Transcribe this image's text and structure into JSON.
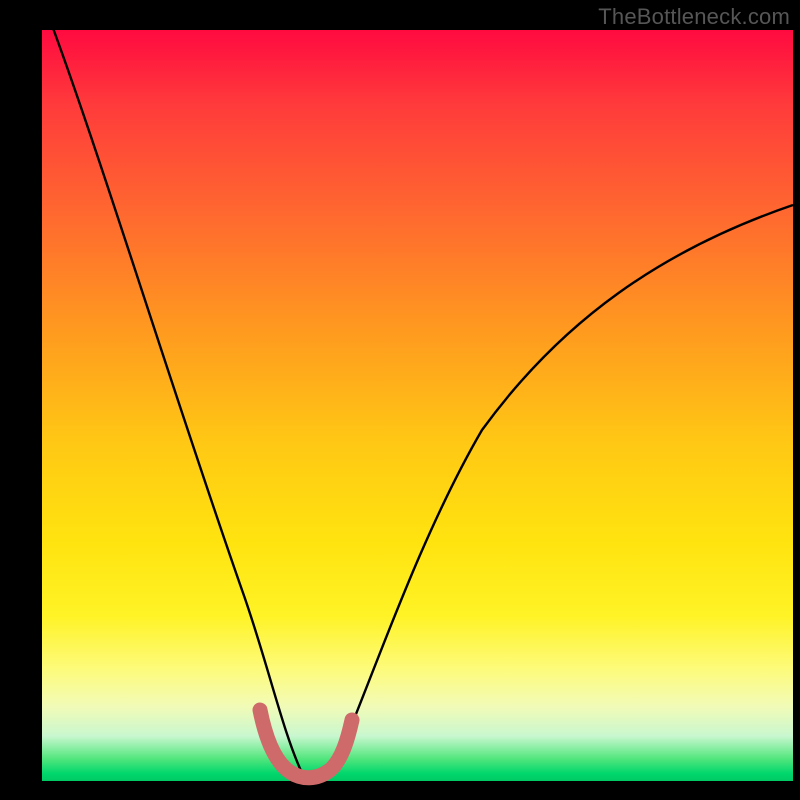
{
  "watermark": "TheBottleneck.com",
  "chart_data": {
    "type": "line",
    "title": "",
    "xlabel": "",
    "ylabel": "",
    "xlim": [
      0,
      100
    ],
    "ylim": [
      0,
      100
    ],
    "x": [
      0,
      5,
      10,
      15,
      20,
      25,
      28,
      30,
      32,
      34,
      36,
      38,
      40,
      45,
      50,
      55,
      60,
      65,
      70,
      75,
      80,
      85,
      90,
      95,
      100
    ],
    "values": [
      100,
      85,
      70,
      55,
      40,
      24,
      13,
      7,
      3,
      1,
      0,
      1,
      3,
      12,
      22,
      32,
      40,
      47,
      53,
      58,
      63,
      67,
      71,
      74,
      77
    ],
    "annotations": [
      {
        "label": "minimum-marker",
        "x_range": [
          29,
          39
        ],
        "shape": "U",
        "color": "#d16666"
      }
    ],
    "gradient_bands": [
      {
        "position": 0,
        "color": "#ff0a40"
      },
      {
        "position": 50,
        "color": "#ffd000"
      },
      {
        "position": 90,
        "color": "#f5ffc0"
      },
      {
        "position": 100,
        "color": "#00c963"
      }
    ]
  }
}
